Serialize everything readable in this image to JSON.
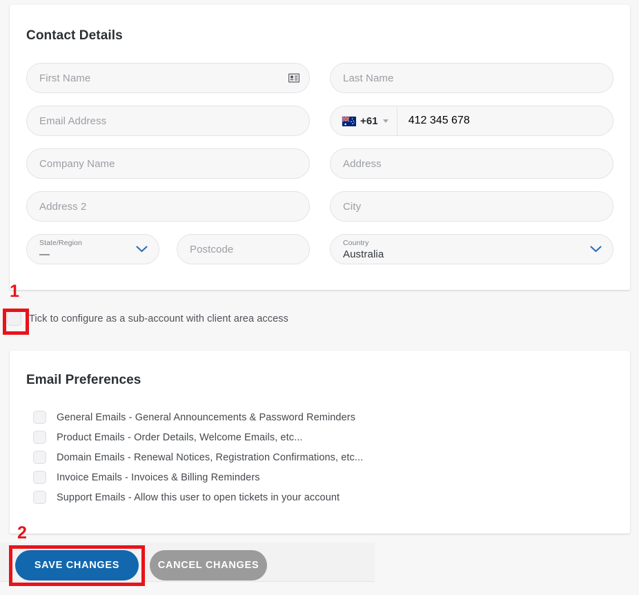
{
  "contact_card": {
    "title": "Contact Details",
    "fields": {
      "first_name_placeholder": "First Name",
      "first_name_icon": "contact-card-icon",
      "last_name_placeholder": "Last Name",
      "email_placeholder": "Email Address",
      "phone_country_flag": "australia-flag-icon",
      "phone_country_code": "+61",
      "phone_placeholder": "412 345 678",
      "company_placeholder": "Company Name",
      "address_placeholder": "Address",
      "address2_placeholder": "Address 2",
      "city_placeholder": "City",
      "state_label": "State/Region",
      "state_value": "—",
      "postcode_placeholder": "Postcode",
      "country_label": "Country",
      "country_value": "Australia"
    }
  },
  "subaccount": {
    "label": "Tick to configure as a sub-account with client area access",
    "checked": false
  },
  "email_card": {
    "title": "Email Preferences",
    "preferences": [
      {
        "label": "General Emails - General Announcements & Password Reminders",
        "checked": false
      },
      {
        "label": "Product Emails - Order Details, Welcome Emails, etc...",
        "checked": false
      },
      {
        "label": "Domain Emails - Renewal Notices, Registration Confirmations, etc...",
        "checked": false
      },
      {
        "label": "Invoice Emails - Invoices & Billing Reminders",
        "checked": false
      },
      {
        "label": "Support Emails - Allow this user to open tickets in your account",
        "checked": false
      }
    ]
  },
  "footer": {
    "save_label": "SAVE CHANGES",
    "cancel_label": "CANCEL CHANGES"
  },
  "annotations": {
    "marker_1": "1",
    "marker_2": "2",
    "color": "#e8131a"
  },
  "colors": {
    "primary_blue": "#1267ad",
    "cancel_gray": "#9b9b9b",
    "page_background": "#f7f7f8",
    "card_background": "#ffffff",
    "field_background": "#f7f7f8"
  }
}
